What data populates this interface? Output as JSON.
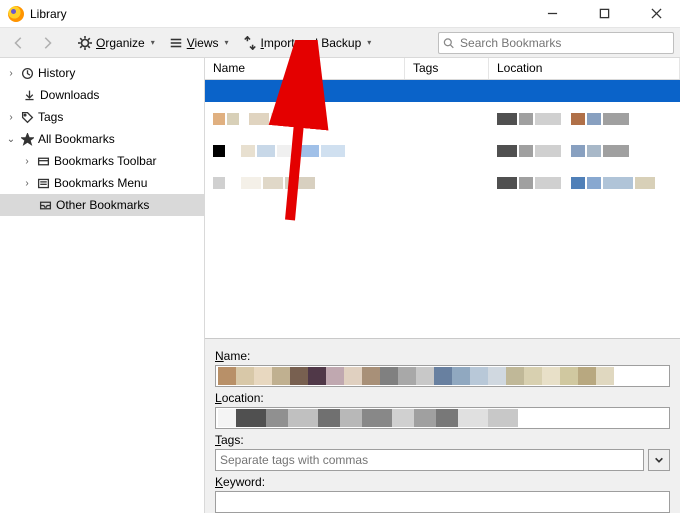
{
  "window": {
    "title": "Library"
  },
  "toolbar": {
    "organize": "Organize",
    "views": "Views",
    "import": "Import and Backup"
  },
  "search": {
    "placeholder": "Search Bookmarks"
  },
  "sidebar": {
    "history": "History",
    "downloads": "Downloads",
    "tags": "Tags",
    "all_bookmarks": "All Bookmarks",
    "toolbar": "Bookmarks Toolbar",
    "menu": "Bookmarks Menu",
    "other": "Other Bookmarks"
  },
  "columns": {
    "name": "Name",
    "tags": "Tags",
    "location": "Location"
  },
  "details": {
    "name_label": "Name:",
    "location_label": "Location:",
    "tags_label": "Tags:",
    "tags_placeholder": "Separate tags with commas",
    "keyword_label": "Keyword:"
  }
}
